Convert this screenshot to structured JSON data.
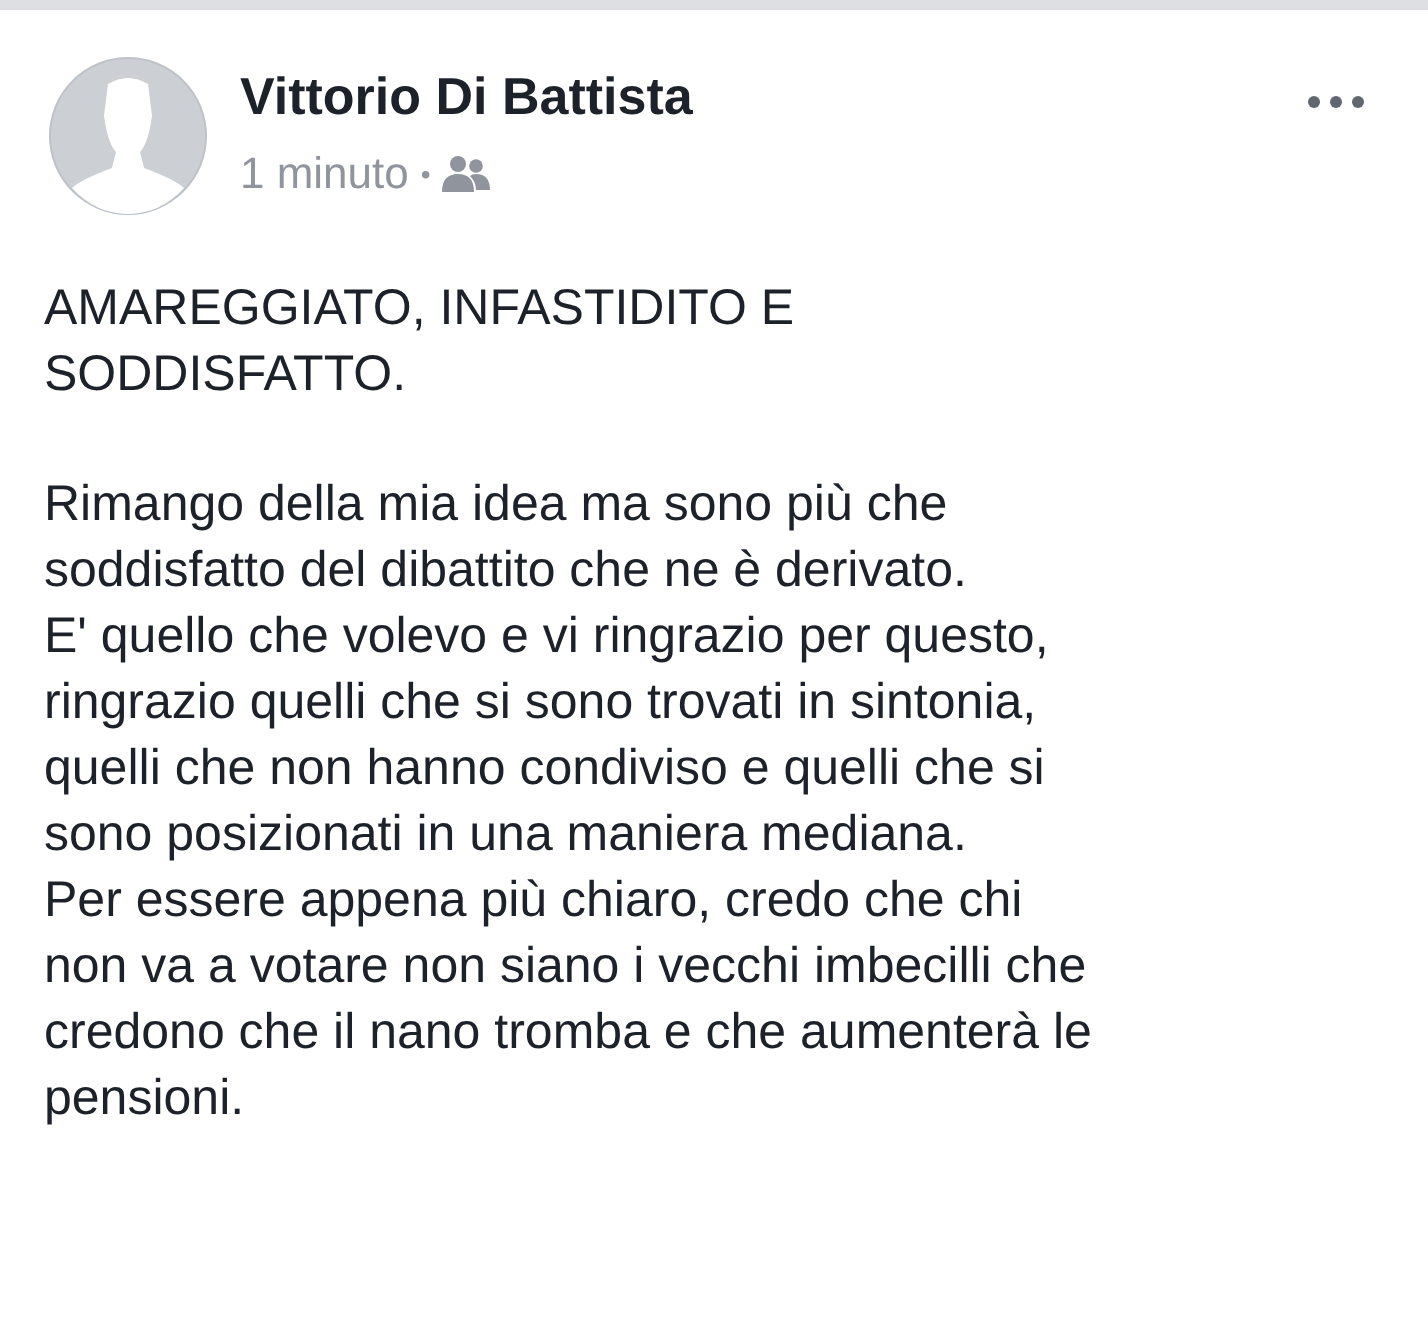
{
  "post": {
    "author": "Vittorio Di Battista",
    "time": "1 minuto",
    "separator": "•",
    "paragraphs": [
      [
        "AMAREGGIATO, INFASTIDITO E",
        "SODDISFATTO."
      ],
      [
        "Rimango della mia idea ma sono più che",
        "soddisfatto del dibattito che ne è derivato.",
        "E' quello che volevo e vi ringrazio per questo,",
        "ringrazio quelli che si sono trovati in sintonia,",
        "quelli che non hanno condiviso e quelli che si",
        "sono posizionati in una maniera mediana.",
        "Per essere appena più chiaro, credo che chi",
        "non va a votare non siano i vecchi imbecilli che",
        "credono che il nano tromba e che aumenterà le",
        "pensioni."
      ]
    ]
  }
}
